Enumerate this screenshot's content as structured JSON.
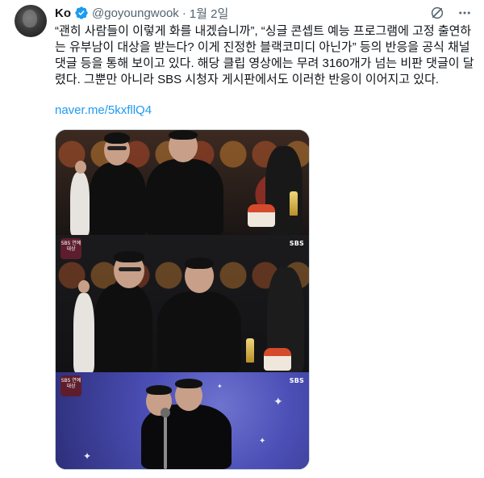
{
  "author": {
    "name": "Ko",
    "handle": "@goyoungwook",
    "separator": "·",
    "date": "1월 2일"
  },
  "header_icons": [
    "grok-icon",
    "more-icon"
  ],
  "tweet": {
    "text": "“괜히 사람들이 이렇게 화를 내겠습니까”, “싱글 콘셉트 예능 프로그램에 고정 출연하는 유부남이 대상을 받는다? 이게 진정한 블랙코미디 아닌가” 등의 반응을 공식 채널 댓글 등을 통해 보이고 있다. 해당 클립 영상에는 무려 3160개가 넘는 비판 댓글이 달렸다. 그뿐만 아니라 SBS 시청자 게시판에서도 이러한 반응이 이어지고 있다.",
    "link": "naver.me/5kxfllQ4"
  },
  "media": {
    "frame2_badge": "SBS 연예 대상",
    "frame3_badge": "SBS 연예 대상",
    "frame2_broadcaster": "SBS",
    "frame3_broadcaster": "SBS"
  },
  "colors": {
    "accent": "#1d9bf0",
    "text": "#0f1419",
    "secondary": "#536471"
  }
}
